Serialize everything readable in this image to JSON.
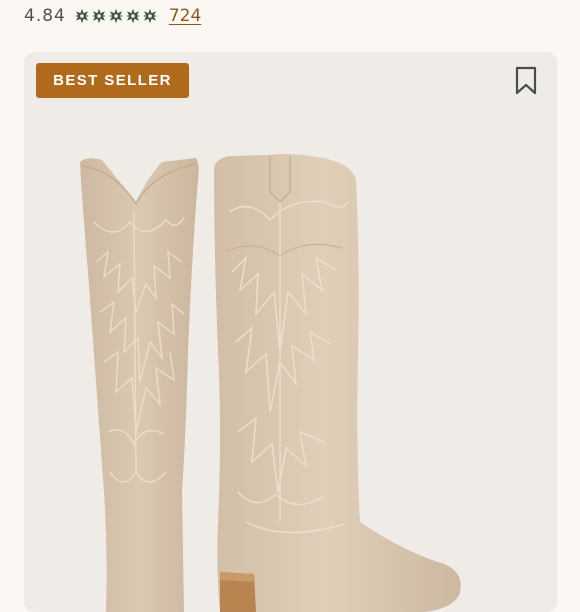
{
  "rating": {
    "value": "4.84",
    "stars": 5,
    "review_count": "724"
  },
  "product": {
    "badge": "BEST SELLER",
    "bookmark_icon": "bookmark-icon",
    "image": "tall sand suede western boots"
  },
  "colors": {
    "star": "#3f5640",
    "badge": "#b06a1c",
    "link": "#8a5a14",
    "card_bg": "#efebe7"
  }
}
